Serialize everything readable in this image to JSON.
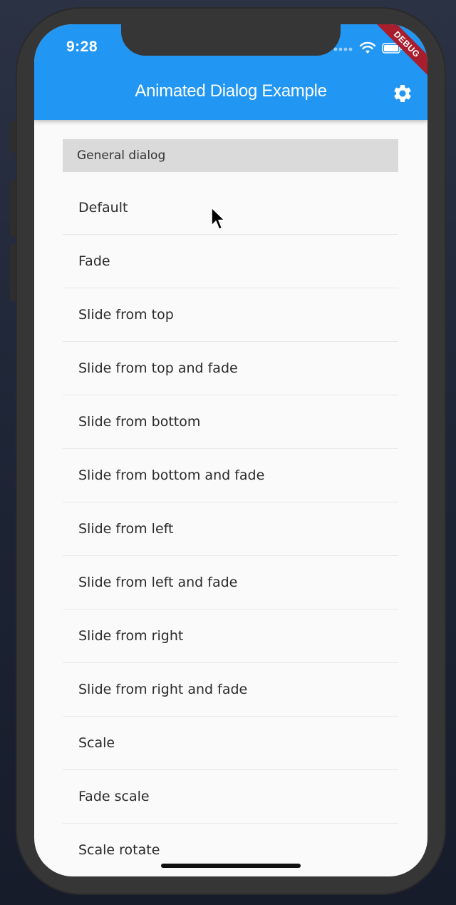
{
  "status_bar": {
    "time": "9:28"
  },
  "app_bar": {
    "title": "Animated Dialog Example",
    "settings_icon": "gear-icon",
    "debug_banner": "DEBUG"
  },
  "section": {
    "header": "General dialog"
  },
  "items": [
    {
      "label": "Default"
    },
    {
      "label": "Fade"
    },
    {
      "label": "Slide from top"
    },
    {
      "label": "Slide from top and fade"
    },
    {
      "label": "Slide from bottom"
    },
    {
      "label": "Slide from bottom and fade"
    },
    {
      "label": "Slide from left"
    },
    {
      "label": "Slide from left and fade"
    },
    {
      "label": "Slide from right"
    },
    {
      "label": "Slide from right and fade"
    },
    {
      "label": "Scale"
    },
    {
      "label": "Fade scale"
    },
    {
      "label": "Scale rotate"
    }
  ],
  "colors": {
    "app_bar": "#2196f3",
    "section_header_bg": "#dadada",
    "debug_ribbon": "#a81e2c",
    "screen_bg": "#fafafa"
  }
}
